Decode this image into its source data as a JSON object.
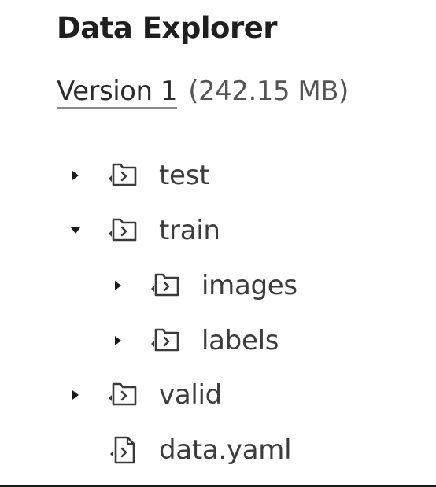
{
  "header": {
    "title": "Data Explorer"
  },
  "version": {
    "link_label": "Version 1",
    "size_label": "(242.15 MB)"
  },
  "tree": {
    "items": [
      {
        "label": "test",
        "kind": "folder",
        "expanded": false,
        "depth": 0
      },
      {
        "label": "train",
        "kind": "folder",
        "expanded": true,
        "depth": 0
      },
      {
        "label": "images",
        "kind": "folder",
        "expanded": false,
        "depth": 1
      },
      {
        "label": "labels",
        "kind": "folder",
        "expanded": false,
        "depth": 1
      },
      {
        "label": "valid",
        "kind": "folder",
        "expanded": false,
        "depth": 0
      },
      {
        "label": "data.yaml",
        "kind": "file",
        "depth": 0
      }
    ]
  },
  "colors": {
    "icon_stroke": "#3a3a3a",
    "caret": "#1a1a1a",
    "bottom_border": "#1a1a1a"
  }
}
